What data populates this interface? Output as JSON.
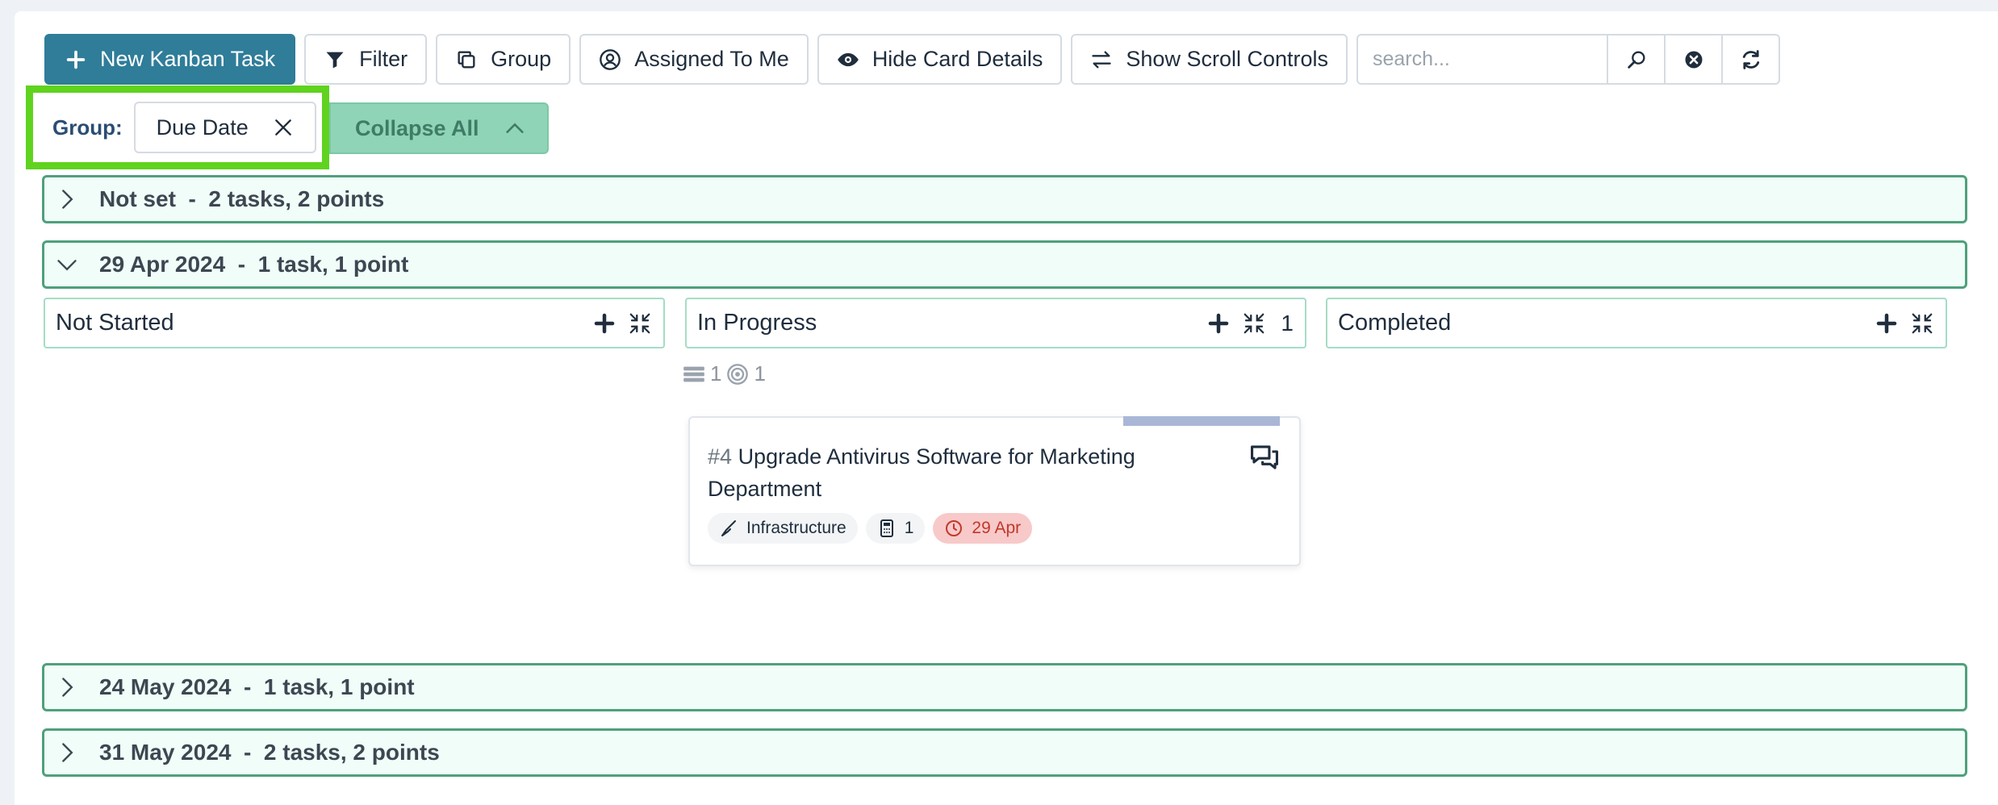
{
  "toolbar": {
    "new_task": "New Kanban Task",
    "filter": "Filter",
    "group": "Group",
    "assigned": "Assigned To Me",
    "hide_details": "Hide Card Details",
    "scroll_controls": "Show Scroll Controls",
    "search_placeholder": "search..."
  },
  "group_filter": {
    "label": "Group:",
    "value": "Due Date",
    "collapse_all": "Collapse All"
  },
  "groups": [
    {
      "title": "Not set  -  2 tasks, 2 points",
      "expanded": false
    },
    {
      "title": "29 Apr 2024  -  1 task, 1 point",
      "expanded": true
    },
    {
      "title": "24 May 2024  -  1 task, 1 point",
      "expanded": false
    },
    {
      "title": "31 May 2024  -  2 tasks, 2 points",
      "expanded": false
    }
  ],
  "columns": [
    {
      "name": "Not Started",
      "count": ""
    },
    {
      "name": "In Progress",
      "count": "1"
    },
    {
      "name": "Completed",
      "count": ""
    }
  ],
  "in_progress_stats": {
    "tasks": "1",
    "points": "1"
  },
  "card": {
    "number": "#4",
    "title": "Upgrade Antivirus Software for Marketing Department",
    "category": "Infrastructure",
    "points": "1",
    "due": "29 Apr",
    "colors": {
      "due_bg": "#f8c9c9",
      "due_text": "#c0392b",
      "accent_bar": "#a9b6d6"
    }
  },
  "colors": {
    "primary": "#2f7d99",
    "group_border": "#4fa07c",
    "group_bg": "#f0fdf8",
    "highlight": "#5fd31e",
    "collapse_bg": "#8fd4b6"
  }
}
